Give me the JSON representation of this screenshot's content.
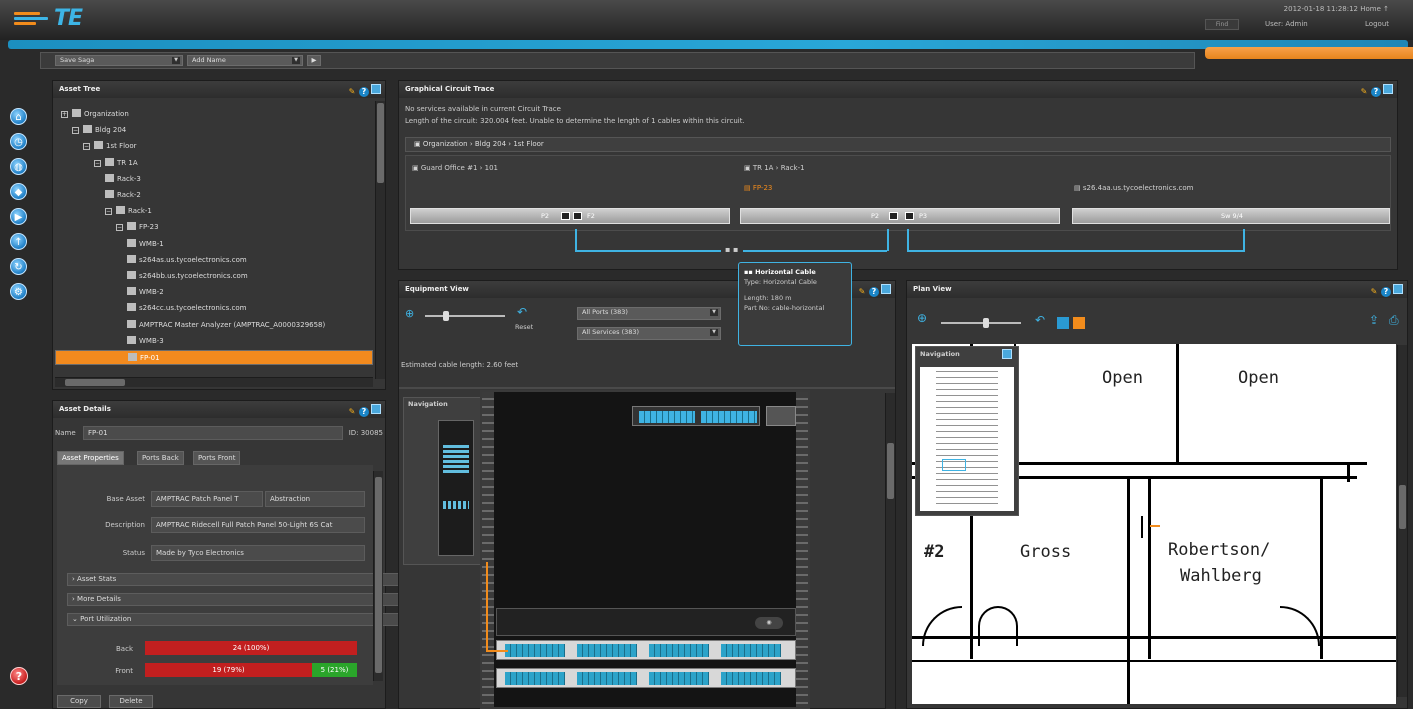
{
  "app": {
    "logo_text": "TE"
  },
  "header": {
    "timestamp": "2012-01-18 11:28:12   Home   ↑",
    "field_placeholder": "Find",
    "user": "User: Admin",
    "logout": "Logout"
  },
  "toolbar": {
    "view_select": "Save Saga",
    "name_select": "Add Name",
    "go_label": "▶"
  },
  "nav": {
    "icons": [
      "home-icon",
      "clock-icon",
      "globe-icon",
      "diamond-icon",
      "play-icon",
      "pin-icon",
      "refresh-icon",
      "gear-icon"
    ],
    "help_glyph": "?"
  },
  "asset_tree": {
    "title": "Asset Tree",
    "items": [
      {
        "label": "Organization",
        "depth": 0,
        "exp": "⊞"
      },
      {
        "label": "Bldg 204",
        "depth": 1,
        "exp": "⊟"
      },
      {
        "label": "1st Floor",
        "depth": 2,
        "exp": "⊟"
      },
      {
        "label": "TR 1A",
        "depth": 3,
        "exp": "⊟"
      },
      {
        "label": "Rack-3",
        "depth": 4,
        "exp": ""
      },
      {
        "label": "Rack-2",
        "depth": 4,
        "exp": ""
      },
      {
        "label": "Rack-1",
        "depth": 4,
        "exp": "⊟"
      },
      {
        "label": "FP-23",
        "depth": 5,
        "exp": "⊟"
      },
      {
        "label": "WMB-1",
        "depth": 6,
        "exp": ""
      },
      {
        "label": "s264as.us.tycoelectronics.com",
        "depth": 6,
        "exp": ""
      },
      {
        "label": "s264bb.us.tycoelectronics.com",
        "depth": 6,
        "exp": ""
      },
      {
        "label": "WMB-2",
        "depth": 6,
        "exp": ""
      },
      {
        "label": "s264cc.us.tycoelectronics.com",
        "depth": 6,
        "exp": ""
      },
      {
        "label": "AMPTRAC Master Analyzer (AMPTRAC_A0000329658)",
        "depth": 6,
        "exp": ""
      },
      {
        "label": "WMB-3",
        "depth": 6,
        "exp": ""
      },
      {
        "label": "FP-01",
        "depth": 6,
        "exp": "",
        "selected": true
      }
    ]
  },
  "asset_details": {
    "title": "Asset Details",
    "name_label": "Name",
    "name_value": "FP-01",
    "id_label": "ID: 30085",
    "tabs": [
      "Asset Properties",
      "Ports Back",
      "Ports Front"
    ],
    "fields": [
      {
        "label": "Base Asset",
        "value": "AMPTRAC Patch Panel T",
        "extra": "Abstraction"
      },
      {
        "label": "Description",
        "value": "AMPTRAC Ridecell Full Patch Panel 50-Light 6S Cat"
      },
      {
        "label": "Status",
        "value": "Made by Tyco Electronics"
      }
    ],
    "sections": [
      "Asset Stats",
      "More Details",
      "Port Utilization"
    ],
    "utilization": [
      {
        "label": "Back",
        "red": "24 (100%)",
        "green": ""
      },
      {
        "label": "Front",
        "red": "19 (79%)",
        "green": "5 (21%)",
        "red_fraction": 0.79
      }
    ],
    "buttons": [
      "Copy",
      "Delete"
    ]
  },
  "circuit": {
    "title": "Graphical Circuit Trace",
    "line1": "No services available in current Circuit Trace",
    "line2": "Length of the circuit: 320.004 feet. Unable to determine the length of 1 cables within this circuit.",
    "breadcrumb": "Organization  ›  Bldg 204  ›  1st Floor",
    "loc1": "Guard Office #1  ›  101",
    "loc2": "TR 1A  ›  Rack-1",
    "loc2_sub": "FP-23",
    "loc3": "s26.4aa.us.tycoelectronics.com",
    "port1": "P2",
    "port1b": "F2",
    "port2": "P2",
    "port2b": "P3",
    "port3": "Sw 9/4"
  },
  "tooltip": {
    "title": "Horizontal Cable",
    "type": "Type: Horizontal Cable",
    "length": "Length: 180 m",
    "part": "Part No: cable-horizontal"
  },
  "equipment": {
    "title": "Equipment View",
    "reset": "Reset",
    "ports_select": "All Ports (383)",
    "services_select": "All Services (383)",
    "est_length": "Estimated cable length: 2.60 feet",
    "nav_title": "Navigation"
  },
  "plan": {
    "title": "Plan View",
    "nav_title": "Navigation",
    "labels": [
      "Open",
      "Open",
      "#2",
      "Gross",
      "Robertson/",
      "Wahlberg"
    ]
  }
}
